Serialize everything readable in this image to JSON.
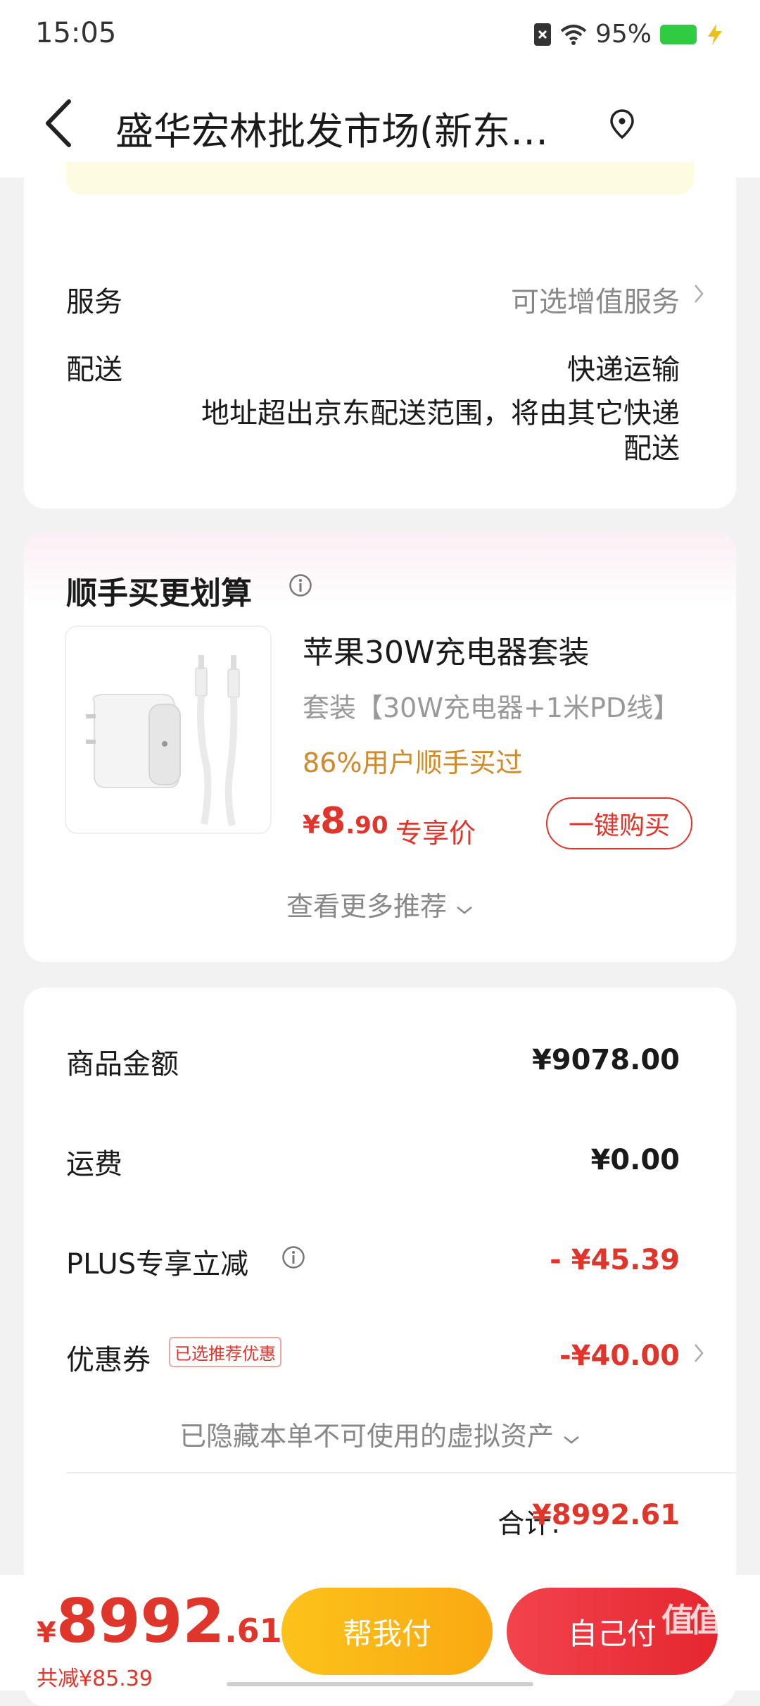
{
  "status_bar": {
    "time": "15:05",
    "battery": "95%"
  },
  "header": {
    "title": "盛华宏林批发市场(新东…"
  },
  "details": {
    "service_label": "服务",
    "service_value": "可选增值服务",
    "delivery_label": "配送",
    "delivery_method": "快递运输",
    "delivery_note_line1": "地址超出京东配送范围，将由其它快递",
    "delivery_note_line2": "配送"
  },
  "recommend": {
    "title": "顺手买更划算",
    "product": {
      "name": "苹果30W充电器套装",
      "spec": "套装【30W充电器+1米PD线】",
      "buyers": "86%用户顺手买过",
      "price_symbol": "¥",
      "price_int": "8",
      "price_dec": ".90",
      "price_tag": "专享价",
      "buy_label": "一键购买"
    },
    "more_label": "查看更多推荐"
  },
  "summary": {
    "goods_label": "商品金额",
    "goods_value": "¥9078.00",
    "shipping_label": "运费",
    "shipping_value": "¥0.00",
    "plus_label": "PLUS专享立减",
    "plus_value": "- ¥45.39",
    "coupon_label": "优惠券",
    "coupon_badge": "已选推荐优惠",
    "coupon_value": "-¥40.00",
    "hidden_assets": "已隐藏本单不可使用的虚拟资产",
    "total_label": "合计:",
    "total_value": "¥8992.61"
  },
  "bottom_bar": {
    "price_symbol": "¥",
    "price_int": "8992",
    "price_dec": ".61",
    "saved": "共减¥85.39",
    "help_pay": "帮我付",
    "self_pay": "自己付",
    "watermark": "值值值"
  },
  "colors": {
    "accent_red": "#e0352b",
    "accent_yellow": "#fcc21a",
    "buyers_orange": "#d08a2a"
  }
}
